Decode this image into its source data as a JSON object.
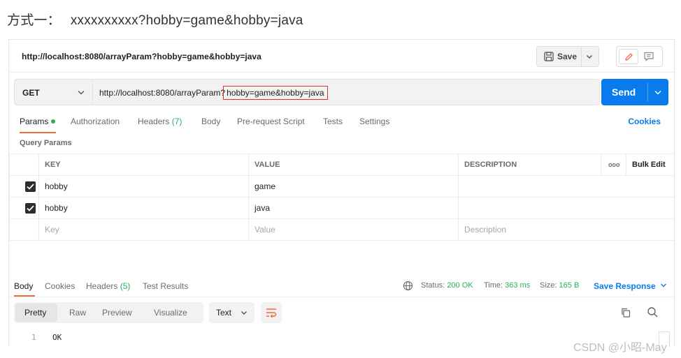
{
  "caption": {
    "label": "方式一：",
    "url": "xxxxxxxxxx?hobby=game&hobby=java"
  },
  "tab": {
    "title": "http://localhost:8080/arrayParam?hobby=game&hobby=java"
  },
  "toolbar": {
    "save_label": "Save"
  },
  "request": {
    "method": "GET",
    "url_base": "http://localhost:8080/arrayParam?",
    "url_query": "hobby=game&hobby=java",
    "send_label": "Send"
  },
  "tabs": {
    "params": "Params",
    "authorization": "Authorization",
    "headers": "Headers",
    "headers_count": "(7)",
    "body": "Body",
    "prerequest": "Pre-request Script",
    "tests": "Tests",
    "settings": "Settings",
    "cookies": "Cookies"
  },
  "query_params": {
    "title": "Query Params",
    "headers": {
      "key": "KEY",
      "value": "VALUE",
      "description": "DESCRIPTION",
      "more": "ooo",
      "bulk": "Bulk Edit"
    },
    "rows": [
      {
        "checked": true,
        "key": "hobby",
        "value": "game",
        "description": ""
      },
      {
        "checked": true,
        "key": "hobby",
        "value": "java",
        "description": ""
      }
    ],
    "placeholder": {
      "key": "Key",
      "value": "Value",
      "description": "Description"
    }
  },
  "response": {
    "tabs": {
      "body": "Body",
      "cookies": "Cookies",
      "headers": "Headers",
      "headers_count": "(5)",
      "tests": "Test Results"
    },
    "status_label": "Status:",
    "status_value": "200 OK",
    "time_label": "Time:",
    "time_value": "363 ms",
    "size_label": "Size:",
    "size_value": "165 B",
    "save_response": "Save Response",
    "views": {
      "pretty": "Pretty",
      "raw": "Raw",
      "preview": "Preview",
      "visualize": "Visualize"
    },
    "format": "Text",
    "lines": [
      {
        "n": "1",
        "text": "OK"
      }
    ]
  },
  "watermark": "CSDN @小昭-May",
  "colors": {
    "accent": "#097bed",
    "tab_underline": "#f26b3a",
    "status_ok": "#27ae60",
    "highlight": "#e0312f"
  }
}
